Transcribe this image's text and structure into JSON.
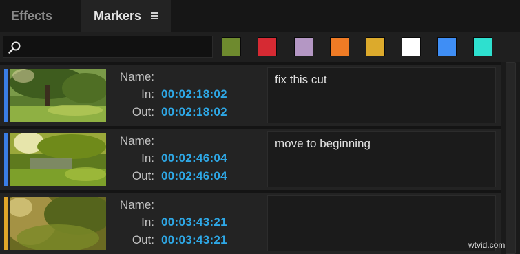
{
  "tabs": [
    {
      "label": "Effects",
      "active": false
    },
    {
      "label": "Markers",
      "active": true
    }
  ],
  "search": {
    "icon": "search-icon"
  },
  "color_filters": [
    {
      "name": "green",
      "color": "#6e8a2e"
    },
    {
      "name": "red",
      "color": "#d62a33"
    },
    {
      "name": "violet",
      "color": "#b497c4"
    },
    {
      "name": "orange",
      "color": "#ef7b25"
    },
    {
      "name": "yellow",
      "color": "#dcaa2c"
    },
    {
      "name": "white",
      "color": "#ffffff"
    },
    {
      "name": "blue",
      "color": "#3f8ef5"
    },
    {
      "name": "cyan",
      "color": "#2ee0cf"
    }
  ],
  "field_labels": {
    "name": "Name:",
    "in": "In:",
    "out": "Out:"
  },
  "markers": [
    {
      "name": "",
      "in": "00:02:18:02",
      "out": "00:02:18:02",
      "comment": "fix this cut",
      "color": "#3a7de6"
    },
    {
      "name": "",
      "in": "00:02:46:04",
      "out": "00:02:46:04",
      "comment": "move to beginning",
      "color": "#3a7de6"
    },
    {
      "name": "",
      "in": "00:03:43:21",
      "out": "00:03:43:21",
      "comment": "",
      "color": "#e0a52a"
    }
  ],
  "watermark": "wtvid.com"
}
